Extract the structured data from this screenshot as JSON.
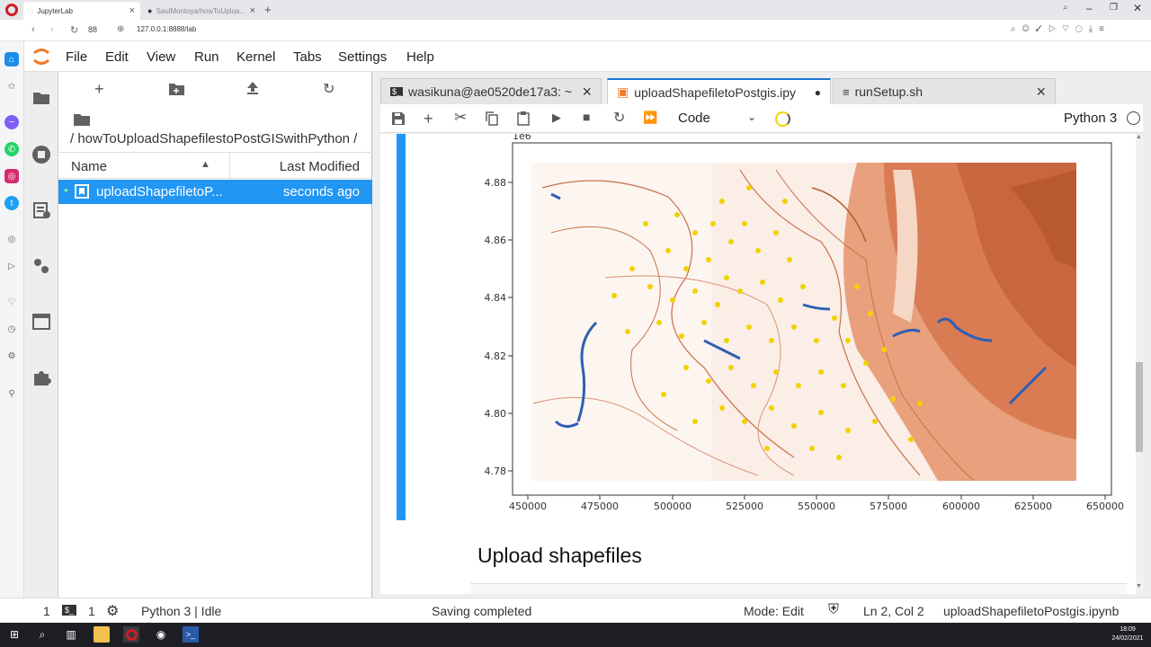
{
  "browser": {
    "tabs": [
      {
        "label": "JupyterLab"
      },
      {
        "label": "SaulMontoya/howToUploa..."
      }
    ],
    "tab_count": "88",
    "url": "127.0.0.1:8888/lab"
  },
  "menu": [
    "File",
    "Edit",
    "View",
    "Run",
    "Kernel",
    "Tabs",
    "Settings",
    "Help"
  ],
  "filebrowser": {
    "path": "/ howToUploadShapefilestoPostGISwithPython /",
    "col_name": "Name",
    "col_modified": "Last Modified",
    "files": [
      {
        "name": "uploadShapefiletoP...",
        "modified": "seconds ago"
      }
    ]
  },
  "doc_tabs": [
    {
      "label": "wasikuna@ae0520de17a3: ~"
    },
    {
      "label": "uploadShapefiletoPostgis.ipy"
    },
    {
      "label": "runSetup.sh"
    }
  ],
  "notebook_toolbar": {
    "cell_type": "Code",
    "kernel": "Python 3"
  },
  "plot": {
    "offset_label": "1e6",
    "y_ticks": [
      "4.88",
      "4.86",
      "4.84",
      "4.82",
      "4.80",
      "4.78"
    ],
    "x_ticks": [
      "450000",
      "475000",
      "500000",
      "525000",
      "550000",
      "575000",
      "600000",
      "625000",
      "650000"
    ]
  },
  "heading": "Upload shapefiles",
  "status": {
    "term_count": "1",
    "kernel_count": "1",
    "kernel": "Python 3 | Idle",
    "message": "Saving completed",
    "mode": "Mode: Edit",
    "position": "Ln 2, Col 2",
    "filename": "uploadShapefiletoPostgis.ipynb"
  },
  "clock": {
    "time": "18:09",
    "date": "24/02/2021"
  },
  "colors": {
    "accent": "#1976d2",
    "contour": "#c8714a",
    "points": "#f2d200",
    "water": "#2f5fb5"
  }
}
